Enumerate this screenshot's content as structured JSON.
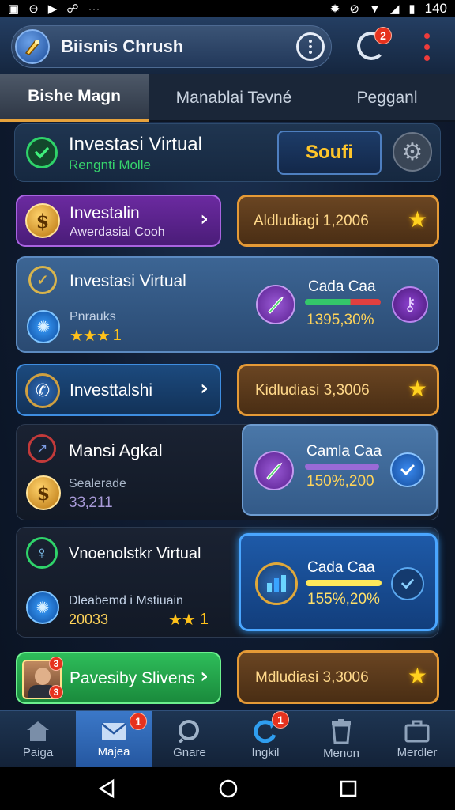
{
  "status_bar": {
    "time": "140",
    "left_icons": [
      "n-icon",
      "circle-minus-icon",
      "play-icon",
      "bug-icon",
      "more-dots-icon"
    ],
    "right_icons": [
      "gear-icon",
      "no-disturb-icon",
      "wifi-icon",
      "signal-icon",
      "battery-icon"
    ]
  },
  "header": {
    "title": "Biisnis Chrush",
    "notification_count": "2"
  },
  "tabs": [
    {
      "label": "Bishe Magn",
      "active": true
    },
    {
      "label": "Manablai Tevné",
      "active": false
    },
    {
      "label": "Pegganl",
      "active": false
    }
  ],
  "top_card": {
    "title": "Investasi Virtual",
    "subtitle": "Rengnti Molle",
    "button_label": "Soufi"
  },
  "row1": {
    "left_title": "Investalin",
    "left_subtitle": "Awerdasial Cooh",
    "right_label": "Aldludiagi 1,2006"
  },
  "card2": {
    "title": "Investasi Virtual",
    "sub_label": "Pnrauks",
    "stars": "★★★",
    "stars_extra": "1",
    "right_title": "Cada Caa",
    "right_value": "1395,30%"
  },
  "row2": {
    "left_title": "Investtalshi",
    "right_label": "Kidludiasi 3,3006"
  },
  "card3": {
    "title": "Mansi Agkal",
    "sub_label": "Sealerade",
    "sub_value": "33‚211",
    "right_title": "Camla Caa",
    "right_value": "150%,200"
  },
  "card4": {
    "title": "Vnoenolstkr Virtual",
    "sub_label": "Dleabemd i Mstiuain",
    "sub_value": "20033",
    "stars": "★★",
    "stars_extra": "1",
    "right_title": "Cada Caa",
    "right_value": "155%,20%"
  },
  "row3": {
    "left_title": "Pavesiby Slivens",
    "left_badges": [
      "3",
      "3"
    ],
    "right_label": "Mdludiasi 3,3006"
  },
  "bottom_nav": [
    {
      "label": "Paiga",
      "icon": "home-icon",
      "active": false,
      "badge": ""
    },
    {
      "label": "Majea",
      "icon": "mail-icon",
      "active": true,
      "badge": "1"
    },
    {
      "label": "Gnare",
      "icon": "search-icon",
      "active": false,
      "badge": ""
    },
    {
      "label": "Ingkil",
      "icon": "refresh-icon",
      "active": false,
      "badge": "1"
    },
    {
      "label": "Menon",
      "icon": "trash-icon",
      "active": false,
      "badge": ""
    },
    {
      "label": "Merdler",
      "icon": "briefcase-icon",
      "active": false,
      "badge": ""
    }
  ],
  "colors": {
    "accent_gold": "#ffc62a",
    "accent_green": "#2fd36a",
    "accent_purple": "#8a2fc4",
    "accent_blue": "#2d8fe6"
  }
}
